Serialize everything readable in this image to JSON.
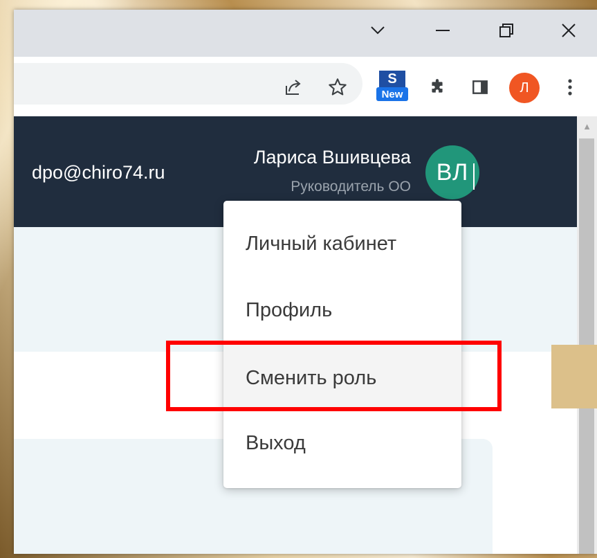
{
  "browser": {
    "window_controls": {
      "tab_search_icon": "chevron-down-icon",
      "minimize_icon": "minimize-icon",
      "restore_icon": "restore-icon",
      "close_icon": "close-icon"
    },
    "toolbar": {
      "share_icon": "share-icon",
      "bookmark_icon": "star-icon",
      "extension_badge_label": "New",
      "extension_badge_letter": "S",
      "extensions_icon": "puzzle-icon",
      "side_panel_icon": "side-panel-icon",
      "profile_initial": "Л",
      "menu_icon": "kebab-menu-icon"
    }
  },
  "header": {
    "email": "dpo@chiro74.ru",
    "user_name": "Лариса Вшивцева",
    "user_role": "Руководитель ОО",
    "avatar_initials": "ВЛ"
  },
  "user_menu": {
    "items": [
      {
        "label": "Личный кабинет"
      },
      {
        "label": "Профиль"
      },
      {
        "label": "Сменить роль"
      },
      {
        "label": "Выход"
      }
    ],
    "highlighted_item": "Сменить роль"
  },
  "colors": {
    "header_bg": "#202d3e",
    "avatar_bg": "#21967a",
    "highlight_border": "#ff0000",
    "profile_button_bg": "#f05623"
  }
}
